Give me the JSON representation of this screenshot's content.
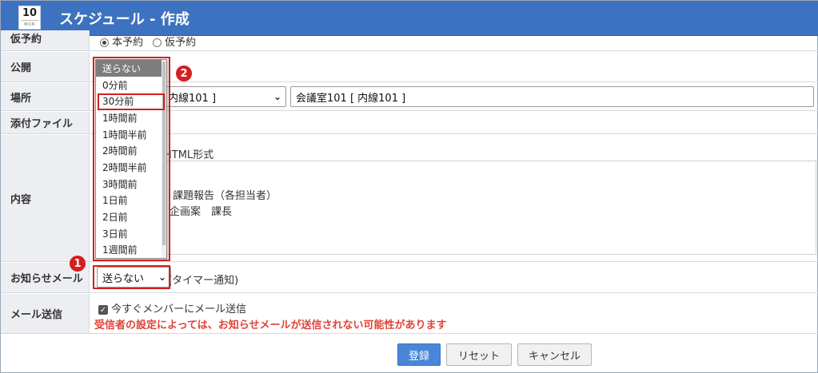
{
  "window": {
    "title": "スケジュール - 作成",
    "icon_day": "10",
    "icon_month": "MON"
  },
  "form": {
    "reservation": {
      "label": "仮予約",
      "option_main": "本予約",
      "option_temp": "仮予約"
    },
    "public": {
      "label": "公開"
    },
    "place": {
      "label": "場所",
      "selected_partial": "内線101 ]",
      "input_value": "会議室101 [ 内線101 ]"
    },
    "attachment": {
      "label": "添付ファイル"
    },
    "content": {
      "label": "内容",
      "html_format": "HTML形式",
      "line1": "課題報告（各担当者）",
      "line2": "企画案　課長"
    },
    "notify": {
      "label": "お知らせメール",
      "selected": "送らない",
      "suffix": "(タイマー通知)"
    },
    "mail": {
      "label": "メール送信",
      "checkbox_label": "今すぐメンバーにメール送信",
      "warning": "受信者の設定によっては、お知らせメールが送信されない可能性があります"
    }
  },
  "dropdown_options": [
    "送らない",
    "0分前",
    "30分前",
    "1時間前",
    "1時間半前",
    "2時間前",
    "2時間半前",
    "3時間前",
    "1日前",
    "2日前",
    "3日前",
    "1週間前"
  ],
  "callouts": {
    "one": "1",
    "two": "2"
  },
  "buttons": {
    "submit": "登録",
    "reset": "リセット",
    "cancel": "キャンセル"
  },
  "colors": {
    "titlebar": "#3d72c0",
    "label_bg": "#eceef1",
    "warning": "#e0433a",
    "callout": "#d31f1f",
    "primary": "#4a86d8"
  }
}
